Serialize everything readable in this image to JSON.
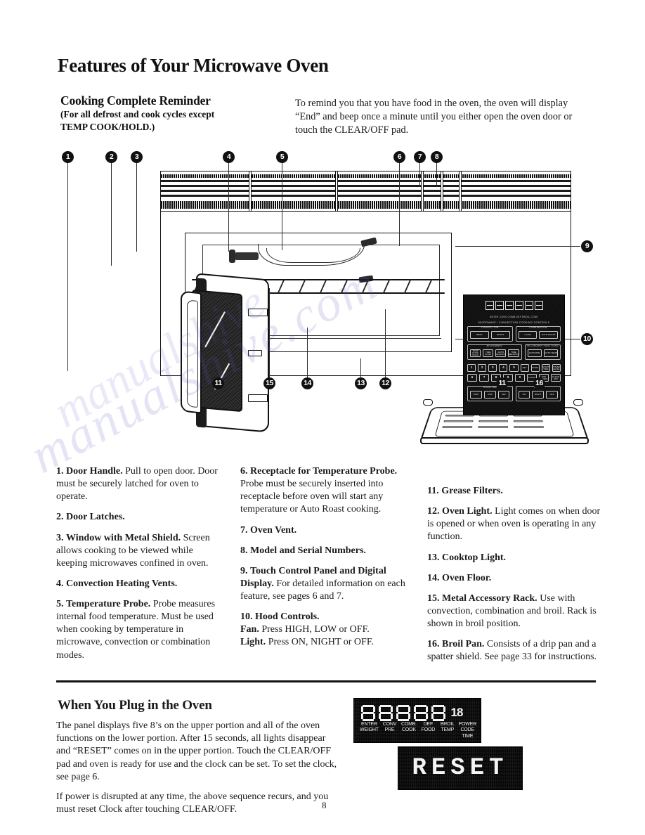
{
  "document": {
    "page_title": "Features of Your Microwave Oven",
    "page_number": "8"
  },
  "reminder": {
    "heading": "Cooking Complete Reminder",
    "subheading_line1": "(For all defrost and cook cycles except",
    "subheading_line2": "TEMP COOK/HOLD.)",
    "body": "To remind you that you have food in the oven, the oven will display “End” and beep once a minute until you either open the oven door or touch the CLEAR/OFF pad."
  },
  "figure": {
    "callouts_top": [
      "1",
      "2",
      "3",
      "4",
      "5",
      "6",
      "7",
      "8"
    ],
    "callouts_right": [
      "9",
      "10"
    ],
    "callouts_bottom": [
      "11",
      "15",
      "14",
      "13",
      "12",
      "11",
      "16"
    ],
    "control_panel": {
      "display_sub_labels": [
        "ENTER WEIGHT",
        "CONV PRE",
        "COMB. COOK",
        "DEF FOOD",
        "BROIL TEMP",
        "POWER CODE TIME"
      ],
      "banner": "MICROWAVE / CONVECTION COOKING CONTROLS",
      "group_convection_title": "CONVECTION",
      "group_convection_keys": [
        "BAKE",
        "ROAST"
      ],
      "group_combination_title": "COMBINATION",
      "group_combination_keys": [
        "1 CON",
        "AUTO ROAST"
      ],
      "group_microwave_title": "MICROWAVE",
      "group_microwave_keys": [
        "TEMP COOK HOLD",
        "TIME COOK",
        "AUTO DEFROST",
        "TIME DEFROST"
      ],
      "group_secondary_title": "SECONDARY FUNCTIONS",
      "group_secondary_keys": [
        "AUTO PRE",
        "AUTO TEMP"
      ],
      "numeric_keys_row1": [
        "1",
        "2",
        "3",
        "4",
        "5"
      ],
      "numeric_keys_row2": [
        "6",
        "7",
        "8",
        "9",
        "0"
      ],
      "function_keys_row1": [
        "SET",
        "COOK",
        "START TIME",
        "POWER LEVEL"
      ],
      "function_keys_row2": [
        "CLOCK",
        "MIN TIMER",
        "CLEAR OFF"
      ],
      "group_hoodfan_title": "HOOD FAN",
      "group_hoodfan_keys": [
        "HIGH",
        "LOW",
        "OFF"
      ],
      "group_hoodlight_title": "LIGHT",
      "group_hoodlight_keys": [
        "ON",
        "NIGHT",
        "OFF"
      ]
    }
  },
  "features": {
    "column1": [
      {
        "number": "1.",
        "term": "Door Handle.",
        "text": " Pull to open door. Door must be securely latched for oven to operate."
      },
      {
        "number": "2.",
        "term": "Door Latches.",
        "text": ""
      },
      {
        "number": "3.",
        "term": "Window with Metal Shield.",
        "text": " Screen allows cooking to be viewed while keeping microwaves confined in oven."
      },
      {
        "number": "4.",
        "term": "Convection Heating Vents.",
        "text": ""
      },
      {
        "number": "5.",
        "term": "Temperature Probe.",
        "text": " Probe measures internal food temperature. Must be used when cooking by temperature in microwave, convection or combination modes."
      }
    ],
    "column2": [
      {
        "number": "6.",
        "term": "Receptacle for Temperature Probe.",
        "text": " Probe must be securely inserted into receptacle before oven will start any temperature or Auto Roast cooking."
      },
      {
        "number": "7.",
        "term": "Oven Vent.",
        "text": ""
      },
      {
        "number": "8.",
        "term": "Model and Serial Numbers.",
        "text": ""
      },
      {
        "number": "9.",
        "term": "Touch Control Panel and Digital Display.",
        "text": " For detailed information on each feature, see pages 6 and 7."
      },
      {
        "number": "10.",
        "term": "Hood Controls.",
        "text": "",
        "sub_lines": [
          {
            "label": "Fan.",
            "text": " Press HIGH, LOW or OFF."
          },
          {
            "label": "Light.",
            "text": " Press ON, NIGHT or OFF."
          }
        ]
      }
    ],
    "column3": [
      {
        "number": "11.",
        "term": "Grease Filters.",
        "text": ""
      },
      {
        "number": "12.",
        "term": "Oven Light.",
        "text": " Light comes on when door is opened or when oven is operating in any function."
      },
      {
        "number": "13.",
        "term": "Cooktop Light.",
        "text": ""
      },
      {
        "number": "14.",
        "term": "Oven Floor.",
        "text": ""
      },
      {
        "number": "15.",
        "term": "Metal Accessory Rack.",
        "text": " Use with convection, combination and broil. Rack is shown in broil position."
      },
      {
        "number": "16.",
        "term": "Broil Pan.",
        "text": " Consists of a drip pan and a spatter shield. See page 33 for instructions."
      }
    ]
  },
  "plug_in": {
    "heading": "When You Plug in the Oven",
    "paragraph1": "The panel displays five 8’s on the upper portion and all of the oven functions on the lower portion. After 15 seconds, all lights disappear and “RESET” comes on in the upper portion. Touch the CLEAR/OFF pad and oven is ready for use and the clock can be set. To set the clock, see page 6.",
    "paragraph2": "If power is disrupted at any time, the above sequence recurs, and you must reset Clock after touching CLEAR/OFF.",
    "display_top": {
      "digits": [
        "8",
        "8",
        "8",
        "8",
        "8"
      ],
      "extra_digit": "18",
      "labels": [
        {
          "line1": "ENTER",
          "line2": "WEIGHT"
        },
        {
          "line1": "CONV",
          "line2": "PRE"
        },
        {
          "line1": "COMB.",
          "line2": "COOK"
        },
        {
          "line1": "DEF",
          "line2": "FOOD"
        },
        {
          "line1": "BROIL",
          "line2": "TEMP"
        },
        {
          "line1": "POWER CODE",
          "line2": "TIME"
        }
      ]
    },
    "display_bottom": {
      "text": "RESET"
    }
  },
  "watermark": {
    "text1": "manualshive.com",
    "text2": "manualshive"
  },
  "colors": {
    "ink": "#111111",
    "paper": "#ffffff",
    "led_background": "#050505",
    "led_segment": "#f2f2f2",
    "watermark": "#5656be"
  }
}
